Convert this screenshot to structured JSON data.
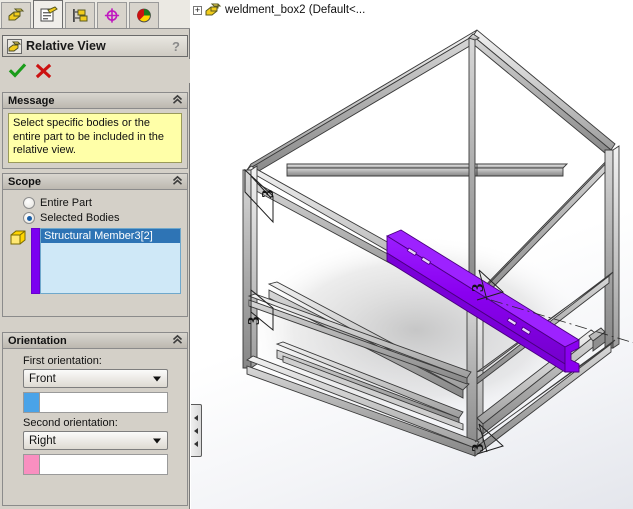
{
  "tabs": [
    {
      "name": "feature-manager-tab",
      "icon": "feature-tree-icon",
      "active": false
    },
    {
      "name": "property-manager-tab",
      "icon": "property-manager-icon",
      "active": true
    },
    {
      "name": "configuration-manager-tab",
      "icon": "configuration-manager-icon",
      "active": false
    },
    {
      "name": "dimxpert-manager-tab",
      "icon": "dimxpert-icon",
      "active": false
    },
    {
      "name": "display-manager-tab",
      "icon": "display-manager-icon",
      "active": false
    }
  ],
  "property_manager": {
    "title": "Relative View",
    "title_icon": "relative-view-icon",
    "help_label": "?",
    "ok_label": "✓",
    "cancel_label": "✗"
  },
  "message": {
    "header": "Message",
    "collapse_icon": "double-chevron-up-icon",
    "text": "Select specific bodies or the entire part to be included in the relative view."
  },
  "scope": {
    "header": "Scope",
    "collapse_icon": "double-chevron-up-icon",
    "options": [
      {
        "label": "Entire Part",
        "checked": false
      },
      {
        "label": "Selected Bodies",
        "checked": true
      }
    ],
    "bodies_icon": "solid-body-icon",
    "selection_bar_color": "#7b00f0",
    "selected_items": [
      "Structural Member3[2]"
    ]
  },
  "orientation": {
    "header": "Orientation",
    "collapse_icon": "double-chevron-up-icon",
    "first": {
      "label": "First orientation:",
      "value": "Front",
      "swatch_color": "#4aa3e8",
      "field_value": ""
    },
    "second": {
      "label": "Second orientation:",
      "value": "Right",
      "swatch_color": "#f98fc0",
      "field_value": ""
    }
  },
  "viewport": {
    "tree_item": {
      "label": "weldment_box2  (Default<...",
      "icon": "part-icon",
      "expander": "+"
    },
    "splitter_name": "panel-splitter-handle",
    "model": {
      "highlight_color": "#8a00f0",
      "frame_color": "#b8b8b8"
    }
  }
}
